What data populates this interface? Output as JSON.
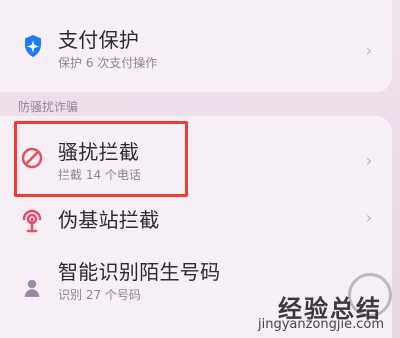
{
  "section_title": "防骚扰诈骗",
  "items": {
    "payment": {
      "title": "支付保护",
      "subtitle": "保护 6 次支付操作",
      "icon": "shield-icon"
    },
    "harass": {
      "title": "骚扰拦截",
      "subtitle": "拦截 14 个电话",
      "icon": "block-icon"
    },
    "fake_station": {
      "title": "伪基站拦截",
      "icon": "antenna-icon"
    },
    "smart_number": {
      "title": "智能识别陌生号码",
      "subtitle": "识别 27 个号码",
      "icon": "person-icon"
    }
  },
  "watermark": {
    "cn": "经验总结",
    "en": "jingyanzongjie.com"
  },
  "colors": {
    "highlight": "#f23a3a",
    "shield": "#1c7cf2",
    "block": "#ea4d5c",
    "antenna": "#ef4a6a",
    "person": "#9e8aa6"
  }
}
